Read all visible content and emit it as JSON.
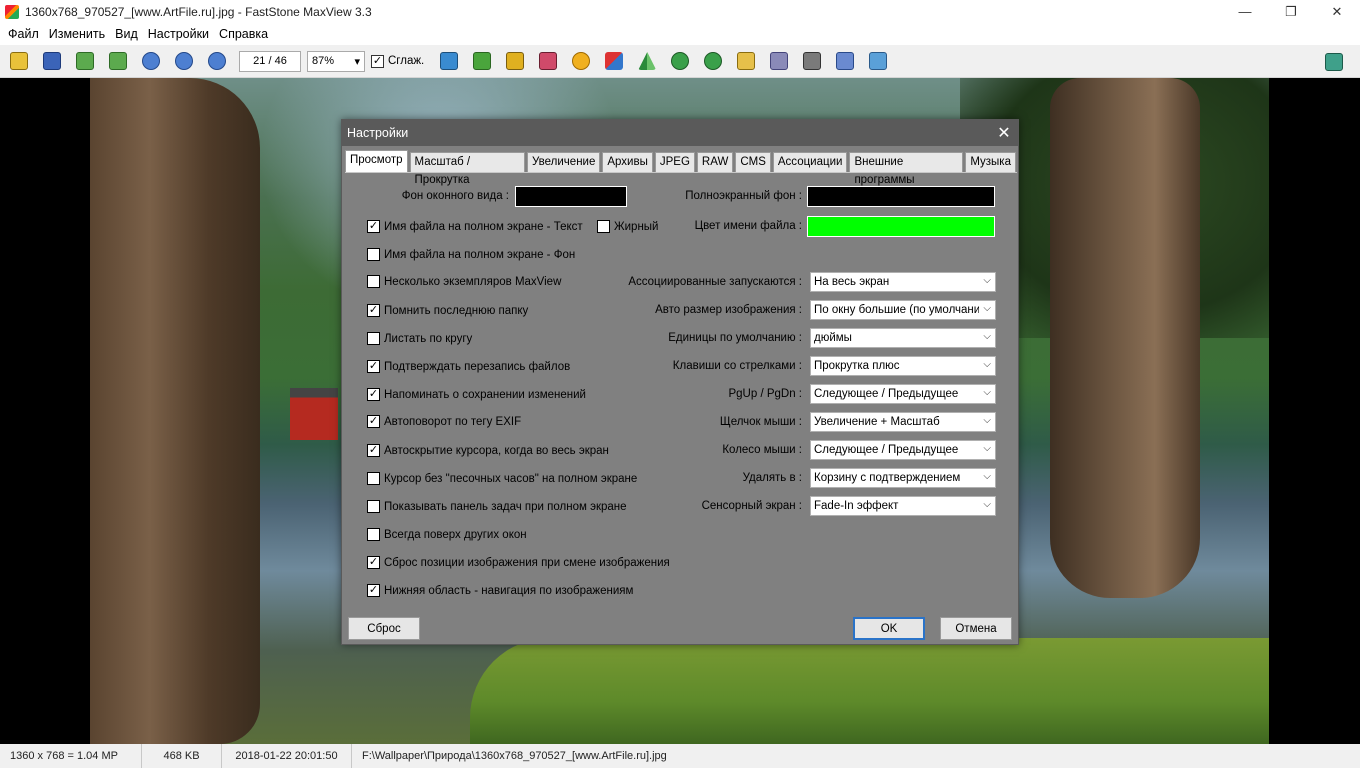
{
  "window": {
    "title": "1360x768_970527_[www.ArtFile.ru].jpg - FastStone MaxView 3.3",
    "minimize": "—",
    "restore": "❐",
    "close": "✕"
  },
  "menu": [
    "Файл",
    "Изменить",
    "Вид",
    "Настройки",
    "Справка"
  ],
  "toolbar": {
    "page": "21 / 46",
    "zoom": "87%",
    "smooth_label": "Сглаж.",
    "smooth_checked": "✓",
    "zoom_arrow": "▾"
  },
  "dialog": {
    "title": "Настройки",
    "close": "✕",
    "tabs": [
      "Просмотр",
      "Масштаб / Прокрутка",
      "Увеличение",
      "Архивы",
      "JPEG",
      "RAW",
      "CMS",
      "Ассоциации",
      "Внешние программы",
      "Музыка"
    ],
    "bg_window_label": "Фон оконного вида :",
    "bg_fullscreen_label": "Полноэкранный фон :",
    "filename_color_label": "Цвет имени файла :",
    "colors": {
      "bg_window": "#000000",
      "bg_fullscreen": "#000000",
      "filename": "#00ff00"
    },
    "bold_label": "Жирный",
    "checkboxes": [
      {
        "label": "Имя файла на полном экране - Текст",
        "mark": "✓"
      },
      {
        "label": "Имя файла на полном экране - Фон",
        "mark": ""
      },
      {
        "label": "Несколько экземпляров MaxView",
        "mark": ""
      },
      {
        "label": "Помнить последнюю папку",
        "mark": "✓"
      },
      {
        "label": "Листать по кругу",
        "mark": ""
      },
      {
        "label": "Подтверждать перезапись файлов",
        "mark": "✓"
      },
      {
        "label": "Напоминать о сохранении изменений",
        "mark": "✓"
      },
      {
        "label": "Автоповорот по тегу EXIF",
        "mark": "✓"
      },
      {
        "label": "Автоскрытие курсора, когда во весь экран",
        "mark": "✓"
      },
      {
        "label": "Курсор без \"песочных часов\" на полном экране",
        "mark": ""
      },
      {
        "label": "Показывать панель задач при полном экране",
        "mark": ""
      },
      {
        "label": "Всегда поверх других окон",
        "mark": ""
      },
      {
        "label": "Сброс позиции изображения при смене изображения",
        "mark": "✓"
      },
      {
        "label": "Нижняя область - навигация по изображениям",
        "mark": "✓"
      }
    ],
    "settings": [
      {
        "label": "Ассоциированные запускаются :",
        "value": "На весь экран"
      },
      {
        "label": "Авто размер изображения :",
        "value": "По окну большие (по умолчанию)"
      },
      {
        "label": "Единицы по умолчанию :",
        "value": "дюймы"
      },
      {
        "label": "Клавиши со стрелками :",
        "value": "Прокрутка плюс"
      },
      {
        "label": "PgUp / PgDn :",
        "value": "Следующее / Предыдущее"
      },
      {
        "label": "Щелчок мыши :",
        "value": "Увеличение + Масштаб"
      },
      {
        "label": "Колесо мыши :",
        "value": "Следующее / Предыдущее"
      },
      {
        "label": "Удалять в :",
        "value": "Корзину с подтверждением"
      },
      {
        "label": "Сенсорный экран :",
        "value": "Fade-In эффект"
      }
    ],
    "select_arrow": "⌵",
    "reset_button": "Сброс",
    "ok_button": "OK",
    "cancel_button": "Отмена"
  },
  "status": {
    "dimensions": "1360 x 768 = 1.04 MP",
    "size": "468 KB",
    "date": "2018-01-22 20:01:50",
    "path": "F:\\Wallpaper\\Природа\\1360x768_970527_[www.ArtFile.ru].jpg"
  }
}
